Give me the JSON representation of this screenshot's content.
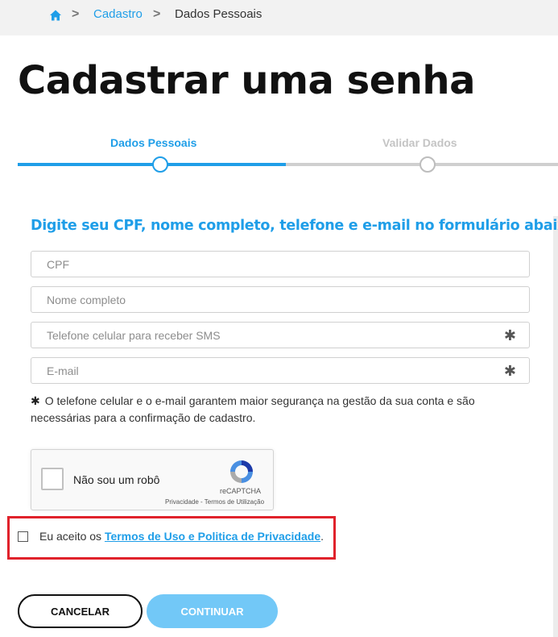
{
  "breadcrumb": {
    "home_icon": "home-icon",
    "separator": ">",
    "link": "Cadastro",
    "current": "Dados Pessoais"
  },
  "page_title": "Cadastrar uma senha",
  "stepper": {
    "steps": [
      {
        "label": "Dados Pessoais",
        "state": "active"
      },
      {
        "label": "Validar Dados",
        "state": "inactive"
      }
    ],
    "active_color": "#1f9ee8",
    "inactive_color": "#cfcfcf"
  },
  "form": {
    "heading": "Digite seu CPF, nome completo, telefone e e-mail no formulário abaixo:",
    "fields": [
      {
        "placeholder": "CPF",
        "value": "",
        "required_marker": ""
      },
      {
        "placeholder": "Nome completo",
        "value": "",
        "required_marker": ""
      },
      {
        "placeholder": "Telefone celular para receber SMS",
        "value": "",
        "required_marker": "✱"
      },
      {
        "placeholder": "E-mail",
        "value": "",
        "required_marker": "✱"
      }
    ],
    "note_marker": "✱",
    "note": "O telefone celular e o e-mail garantem maior segurança na gestão da sua conta e são necessárias para a confirmação de cadastro."
  },
  "captcha": {
    "label": "Não sou um robô",
    "brand": "reCAPTCHA",
    "links": "Privacidade - Termos de Utilização",
    "checked": false
  },
  "terms": {
    "prefix": "Eu aceito os ",
    "link": "Termos de Uso e Politica de Privacidade",
    "suffix": ".",
    "checked": false,
    "highlight_color": "#e0222b"
  },
  "buttons": {
    "cancel": "CANCELAR",
    "continue": "CONTINUAR"
  },
  "colors": {
    "accent": "#1f9ee8",
    "continue_disabled": "#72c8f7"
  }
}
